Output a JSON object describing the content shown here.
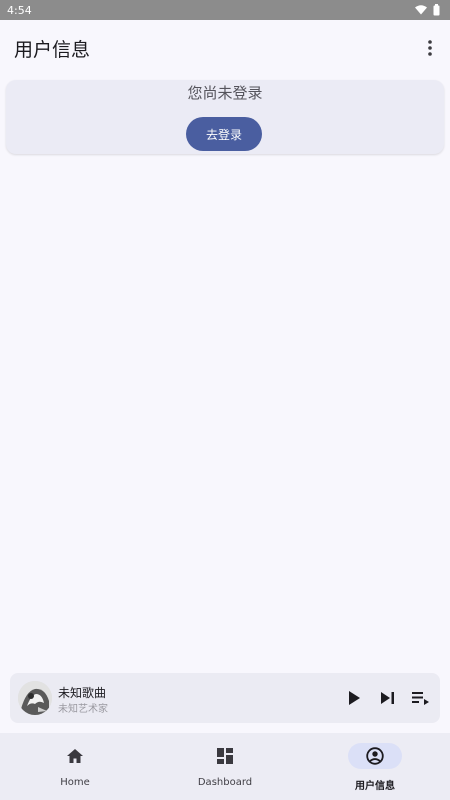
{
  "status_bar": {
    "time": "4:54"
  },
  "app_bar": {
    "title": "用户信息"
  },
  "login_card": {
    "prompt": "您尚未登录",
    "button_label": "去登录"
  },
  "mini_player": {
    "song_title": "未知歌曲",
    "artist": "未知艺术家"
  },
  "bottom_nav": {
    "items": [
      {
        "label": "Home",
        "icon": "home-icon"
      },
      {
        "label": "Dashboard",
        "icon": "dashboard-icon"
      },
      {
        "label": "用户信息",
        "icon": "account-circle-icon",
        "active": true
      }
    ]
  },
  "colors": {
    "background": "#f8f7fd",
    "status_bar": "#8c8c8c",
    "primary": "#4a5ea0",
    "card": "#ebebf5",
    "nav_active_indicator": "#dbe0f7"
  }
}
